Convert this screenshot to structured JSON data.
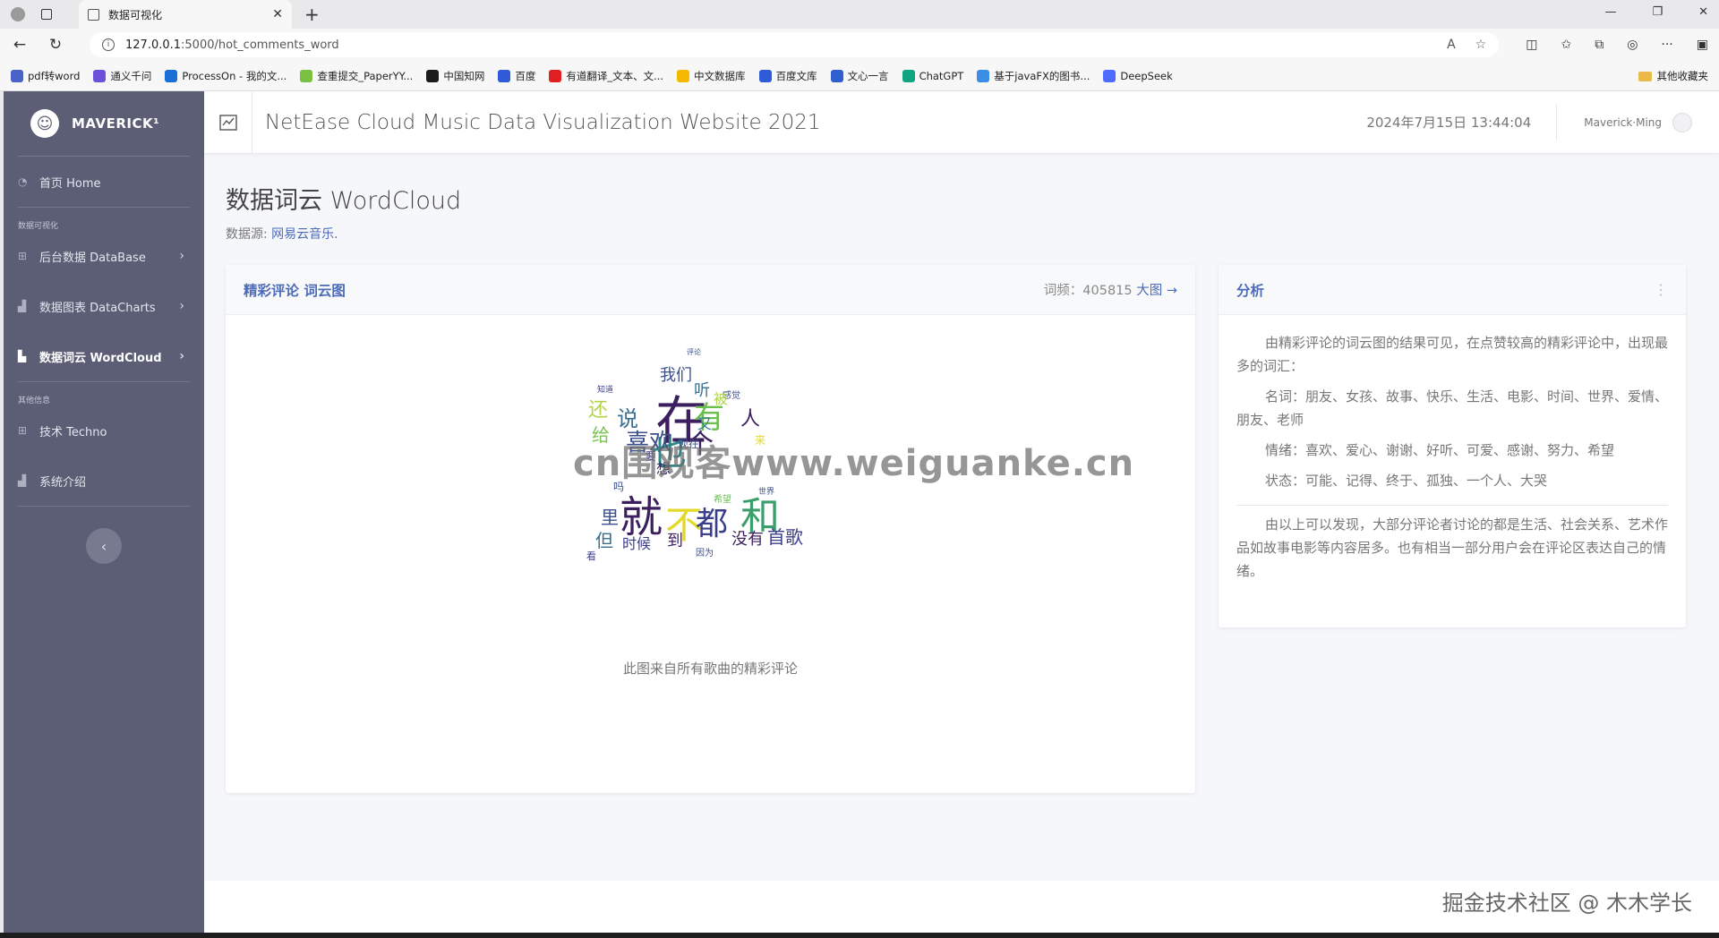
{
  "browser": {
    "tab_title": "数据可视化",
    "url_prefix": "127.0.0.1",
    "url_rest": ":5000/hot_comments_word",
    "bookmarks": [
      {
        "label": "pdf转word",
        "color": "#4a63c9"
      },
      {
        "label": "通义千问",
        "color": "#6b52d8"
      },
      {
        "label": "ProcessOn - 我的文...",
        "color": "#1a6fd6"
      },
      {
        "label": "查重提交_PaperYY...",
        "color": "#7bc043"
      },
      {
        "label": "中国知网",
        "color": "#1b1b1b"
      },
      {
        "label": "百度",
        "color": "#2f5bd8"
      },
      {
        "label": "有道翻译_文本、文...",
        "color": "#e02020"
      },
      {
        "label": "中文数据库",
        "color": "#f5b800"
      },
      {
        "label": "百度文库",
        "color": "#2f5bd8"
      },
      {
        "label": "文心一言",
        "color": "#3060d0"
      },
      {
        "label": "ChatGPT",
        "color": "#10a37f"
      },
      {
        "label": "基于javaFX的图书...",
        "color": "#3a8ee6"
      },
      {
        "label": "DeepSeek",
        "color": "#4d6bfe"
      }
    ],
    "other_bookmarks": "其他收藏夹"
  },
  "sidebar": {
    "brand": "MAVERICK¹",
    "items": [
      {
        "label": "首页 Home"
      },
      {
        "label": "后台数据 DataBase"
      },
      {
        "label": "数据图表 DataCharts"
      },
      {
        "label": "数据词云 WordCloud"
      },
      {
        "label": "技术 Techno"
      },
      {
        "label": "系统介绍"
      }
    ],
    "section_viz": "数据可视化",
    "section_other": "其他信息",
    "collapse_icon": "‹"
  },
  "topbar": {
    "title": "NetEase Cloud Music Data Visualization Website 2021",
    "datetime": "2024年7月15日 13:44:04",
    "user": "Maverick·Ming"
  },
  "page": {
    "title": "数据词云 WordCloud",
    "source_label": "数据源: ",
    "source_link": "网易云音乐."
  },
  "wordcloud_card": {
    "title": "精彩评论 词云图",
    "freq_label": "词频：405815 ",
    "big_link": "大图 →",
    "caption": "此图来自所有歌曲的精彩评论"
  },
  "analysis_card": {
    "title": "分析",
    "p1": "由精彩评论的词云图的结果可见，在点赞较高的精彩评论中，出现最多的词汇：",
    "p2": "名词：朋友、女孩、故事、快乐、生活、电影、时间、世界、爱情、朋友、老师",
    "p3": "情绪：喜欢、爱心、谢谢、好听、可爱、感谢、努力、希望",
    "p4": "状态：可能、记得、终于、孤独、一个人、大哭",
    "p5": "由以上可以发现，大部分评论者讨论的都是生活、社会关系、艺术作品如故事电影等内容居多。也有相当一部分用户会在评论区表达自己的情绪。"
  },
  "watermark": "cn围观客www.weiguanke.cn",
  "footer_mark": "掘金技术社区 @ 木木学长",
  "icons": {
    "back": "back-arrow-icon",
    "reload": "reload-icon",
    "star": "favorite-icon",
    "chart": "line-chart-icon"
  },
  "colors": {
    "sidebar_bg": "#5b5e75",
    "accent": "#4d6bb8"
  }
}
